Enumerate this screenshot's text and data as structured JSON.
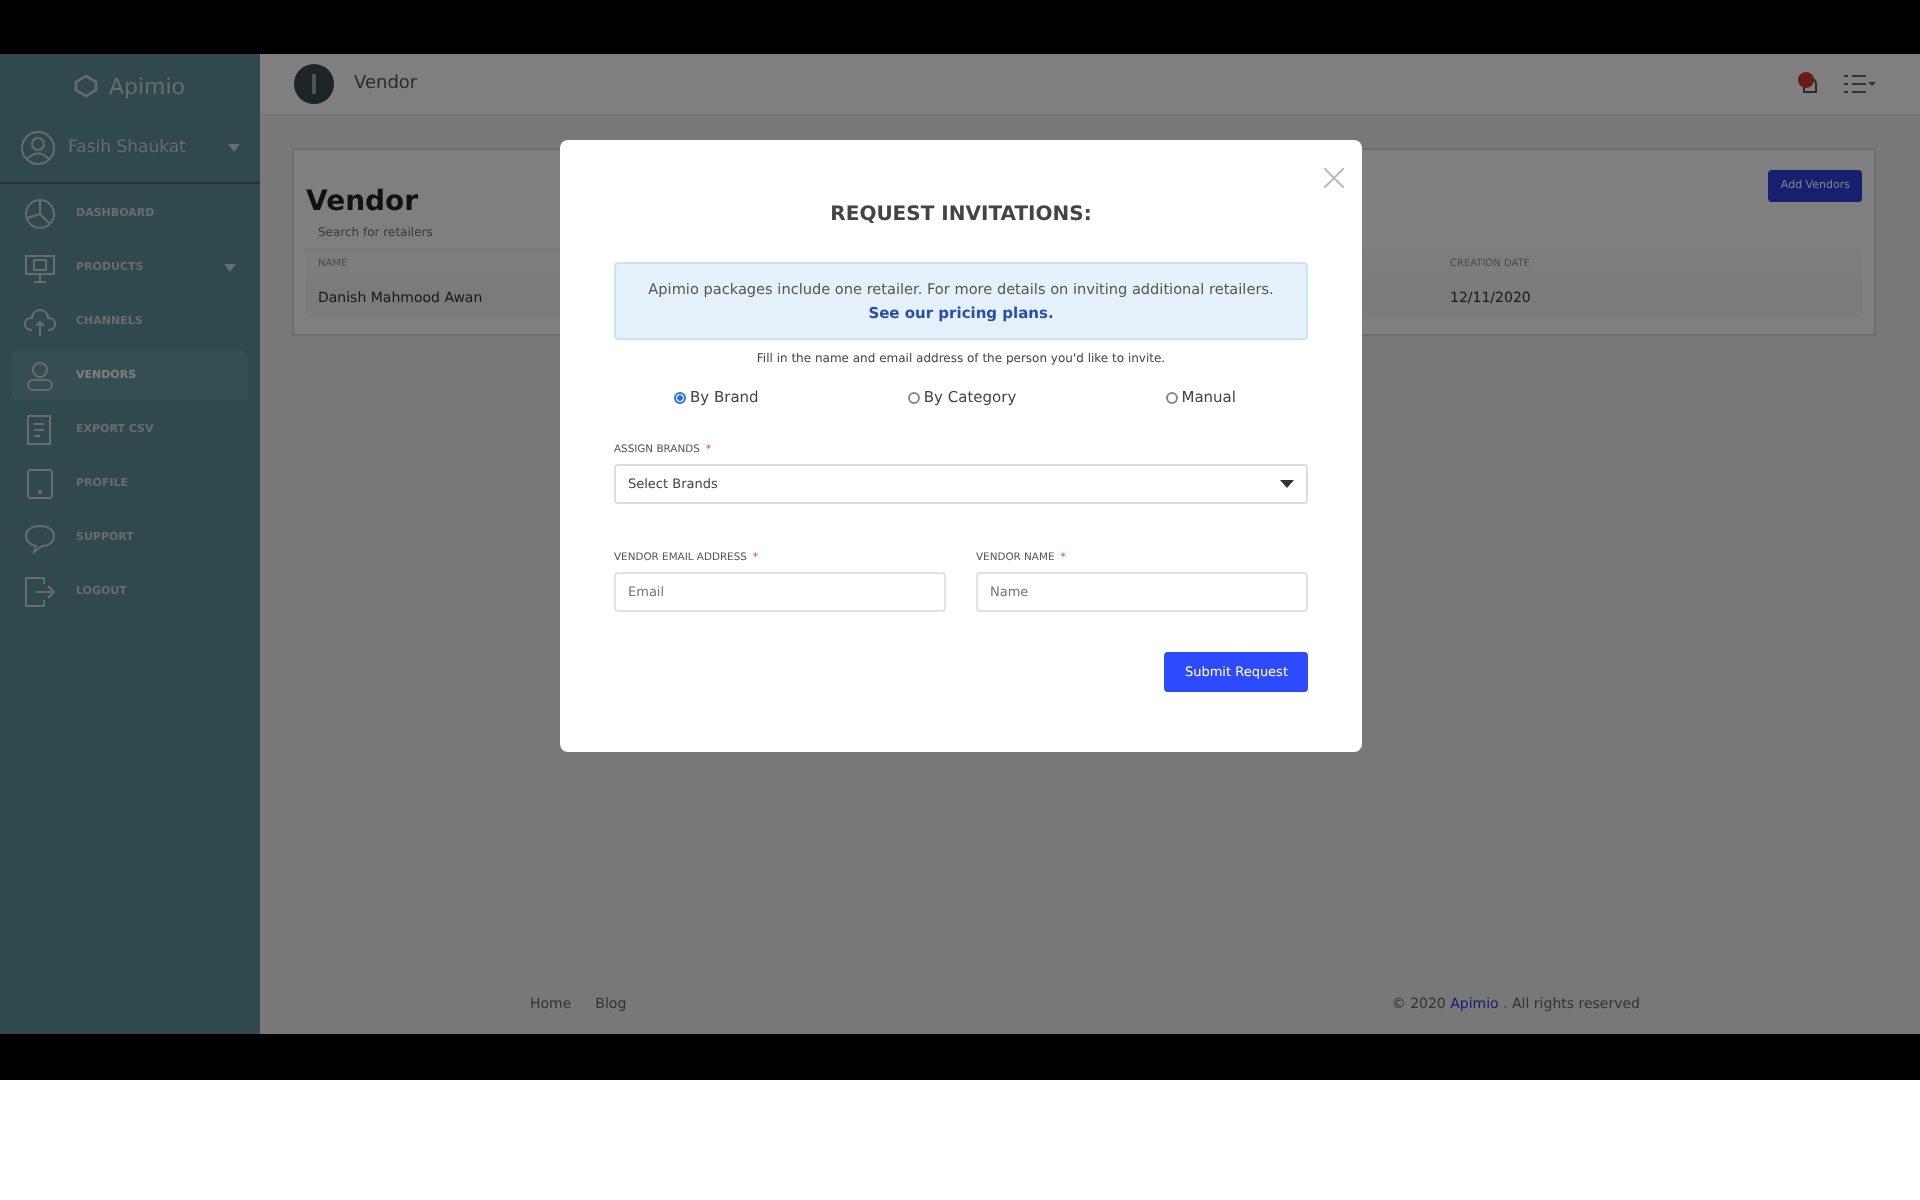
{
  "sidebar": {
    "logo": "Apimio",
    "user": "Fasih Shaukat",
    "items": [
      {
        "label": "DASHBOARD",
        "selected": false,
        "has_caret": false
      },
      {
        "label": "PRODUCTS",
        "selected": false,
        "has_caret": true
      },
      {
        "label": "CHANNELS",
        "selected": false,
        "has_caret": false
      },
      {
        "label": "VENDORS",
        "selected": true,
        "has_caret": false
      },
      {
        "label": "EXPORT CSV",
        "selected": false,
        "has_caret": false
      },
      {
        "label": "PROFILE",
        "selected": false,
        "has_caret": false
      },
      {
        "label": "SUPPORT",
        "selected": false,
        "has_caret": false
      },
      {
        "label": "LOGOUT",
        "selected": false,
        "has_caret": false
      }
    ]
  },
  "header": {
    "title": "Vendor"
  },
  "page": {
    "title": "Vendor",
    "add_button": "Add Vendors",
    "search": {
      "placeholder": "Search for retailers"
    },
    "table": {
      "columns": [
        "NAME",
        "CREATION DATE"
      ],
      "rows": [
        [
          "Danish Mahmood Awan",
          "12/11/2020"
        ]
      ]
    }
  },
  "modal": {
    "title": "REQUEST INVITATIONS:",
    "info": "Apimio packages include one retailer. For more details on inviting additional retailers.",
    "info_link": "See our pricing plans.",
    "hint": "Fill in the name and email address of the person you'd like to invite.",
    "options": [
      {
        "label": "By Brand",
        "selected": true
      },
      {
        "label": "By Category",
        "selected": false
      },
      {
        "label": "Manual",
        "selected": false
      }
    ],
    "brands": {
      "label": "ASSIGN BRANDS",
      "required_mark": "*",
      "value": "Select Brands"
    },
    "fields": [
      {
        "label": "VENDOR EMAIL ADDRESS",
        "required_mark": "*",
        "placeholder": "Email"
      },
      {
        "label": "VENDOR NAME",
        "required_mark": "*",
        "placeholder": "Name"
      }
    ],
    "submit": "Submit Request"
  },
  "footer": {
    "links": [
      "Home",
      "Blog"
    ],
    "copyright_before": "© 2020",
    "copyright_link": "Apimio",
    "copyright_after": ". All rights reserved"
  }
}
